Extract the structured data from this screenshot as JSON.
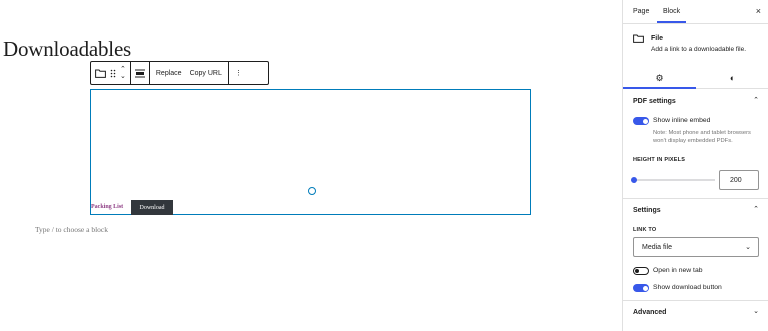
{
  "post": {
    "title": "Downloadables"
  },
  "toolbar": {
    "replace_label": "Replace",
    "copy_url_label": "Copy URL",
    "up_arrow": "⌃",
    "down_arrow": "⌄",
    "more": "⋮",
    "drag": "⠿"
  },
  "file_block": {
    "link_text": "Packing List",
    "download_label": "Download"
  },
  "appender": {
    "placeholder": "Type / to choose a block"
  },
  "sidebar": {
    "tabs": [
      {
        "label": "Page"
      },
      {
        "label": "Block"
      }
    ],
    "close": "×",
    "card": {
      "title": "File",
      "description": "Add a link to a downloadable file."
    },
    "style_tabs": {
      "settings_icon": "⚙",
      "styles_icon": "◐"
    },
    "pdf_settings": {
      "title": "PDF settings",
      "chevron": "⌃",
      "show_inline_embed": "Show inline embed",
      "show_inline_embed_on": true,
      "help_text": "Note: Most phone and tablet browsers won't display embedded PDFs.",
      "height_label": "HEIGHT IN PIXELS",
      "height_value": "200"
    },
    "settings": {
      "title": "Settings",
      "chevron": "⌃",
      "link_to_label": "LINK TO",
      "link_to_value": "Media file",
      "select_chevron": "⌄",
      "open_new_tab": "Open in new tab",
      "open_new_tab_on": false,
      "show_download_button": "Show download button",
      "show_download_button_on": true
    },
    "advanced": {
      "title": "Advanced",
      "chevron": "⌄"
    }
  }
}
